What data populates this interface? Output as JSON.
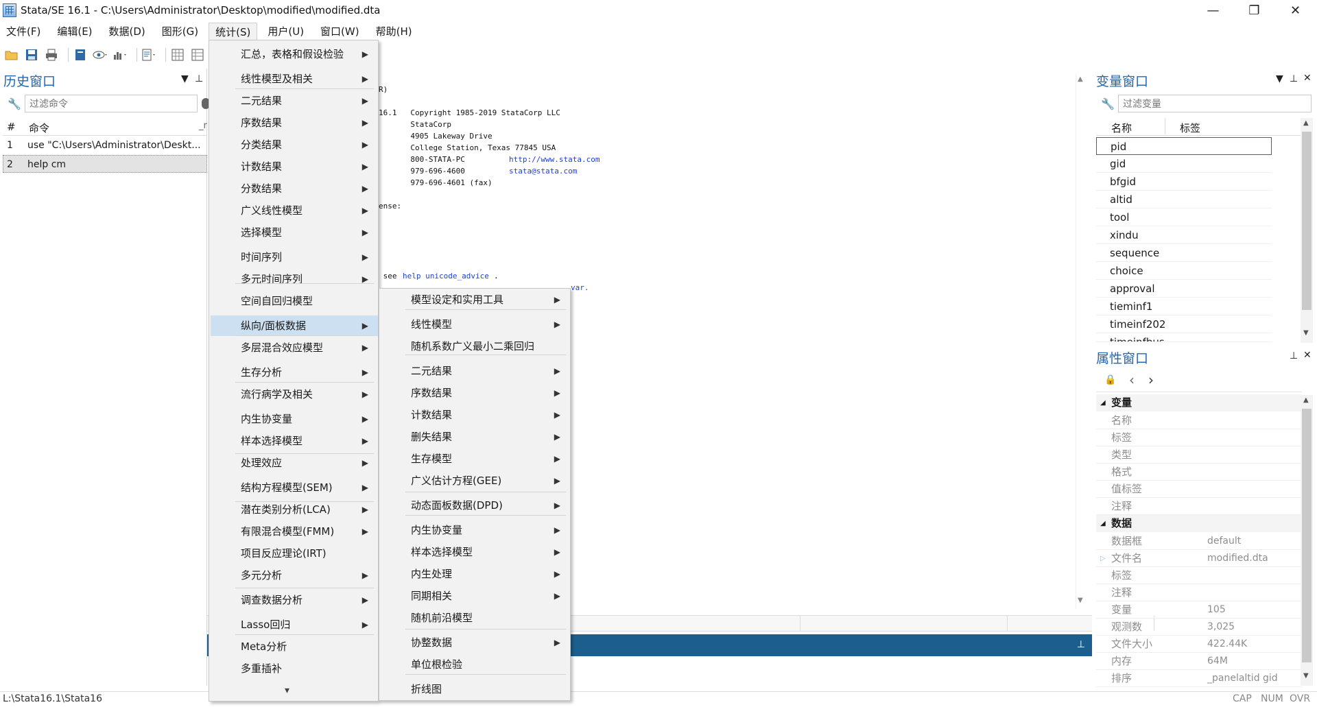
{
  "window": {
    "title": "Stata/SE 16.1 - C:\\Users\\Administrator\\Desktop\\modified\\modified.dta",
    "min": "—",
    "max": "❐",
    "close": "✕"
  },
  "menubar": [
    "文件(F)",
    "编辑(E)",
    "数据(D)",
    "图形(G)",
    "统计(S)",
    "用户(U)",
    "窗口(W)",
    "帮助(H)"
  ],
  "history": {
    "title": "历史窗口",
    "filter_placeholder": "过滤命令",
    "col_num": "#",
    "col_cmd": "命令",
    "col_rc": "_r",
    "rows": [
      {
        "n": "1",
        "cmd": "use \"C:\\Users\\Administrator\\Deskt..."
      },
      {
        "n": "2",
        "cmd": "help cm"
      }
    ]
  },
  "results": {
    "lines": [
      {
        "text": "R)"
      },
      {
        "text": "16.1   Copyright 1985-2019 StataCorp LLC"
      },
      {
        "text": "       StataCorp"
      },
      {
        "text": "       4905 Lakeway Drive"
      },
      {
        "text": "       College Station, Texas 77845 USA"
      },
      {
        "text": "       800-STATA-PC"
      },
      {
        "text": "       979-696-4600"
      },
      {
        "text": "       979-696-4601 (fax)"
      },
      {
        "text": "ense:"
      },
      {
        "text": " see "
      }
    ],
    "url": "http://www.stata.com",
    "email": "stata@stata.com",
    "help_link": "help unicode_advice",
    "help_tail": ".",
    "partial": "var."
  },
  "variables": {
    "title": "变量窗口",
    "filter_placeholder": "过滤变量",
    "col_name": "名称",
    "col_label": "标签",
    "rows": [
      "pid",
      "gid",
      "bfgid",
      "altid",
      "tool",
      "xindu",
      "sequence",
      "choice",
      "approval",
      "tieminf1",
      "timeinf202",
      "timeinfbus"
    ]
  },
  "properties": {
    "title": "属性窗口",
    "sec_var": "变量",
    "var_rows": [
      "名称",
      "标签",
      "类型",
      "格式",
      "值标签",
      "注释"
    ],
    "sec_data": "数据",
    "data_rows": [
      {
        "k": "数据框",
        "v": "default"
      },
      {
        "k": "文件名",
        "v": "modified.dta"
      },
      {
        "k": "标签",
        "v": ""
      },
      {
        "k": "注释",
        "v": ""
      },
      {
        "k": "变量",
        "v": "105"
      },
      {
        "k": "观测数",
        "v": "3,025"
      },
      {
        "k": "文件大小",
        "v": "422.44K"
      },
      {
        "k": "内存",
        "v": "64M"
      },
      {
        "k": "排序",
        "v": "_panelaltid gid"
      }
    ]
  },
  "statusbar": {
    "path": "L:\\Stata16.1\\Stata16",
    "cap": "CAP",
    "num": "NUM",
    "ovr": "OVR"
  },
  "stats_menu": {
    "items": [
      {
        "label": "汇总，表格和假设检验",
        "sub": true
      },
      {
        "label": "线性模型及相关",
        "sub": true
      },
      {
        "label": "二元结果",
        "sub": true
      },
      {
        "label": "序数结果",
        "sub": true
      },
      {
        "label": "分类结果",
        "sub": true
      },
      {
        "label": "计数结果",
        "sub": true
      },
      {
        "label": "分数结果",
        "sub": true
      },
      {
        "label": "广义线性模型",
        "sub": true
      },
      {
        "label": "选择模型",
        "sub": true
      },
      {
        "label": "时间序列",
        "sub": true
      },
      {
        "label": "多元时间序列",
        "sub": true
      },
      {
        "label": "空间自回归模型",
        "sub": false
      },
      {
        "label": "纵向/面板数据",
        "sub": true
      },
      {
        "label": "多层混合效应模型",
        "sub": true
      },
      {
        "label": "生存分析",
        "sub": true
      },
      {
        "label": "流行病学及相关",
        "sub": true
      },
      {
        "label": "内生协变量",
        "sub": true
      },
      {
        "label": "样本选择模型",
        "sub": true
      },
      {
        "label": "处理效应",
        "sub": true
      },
      {
        "label": "结构方程模型(SEM)",
        "sub": true
      },
      {
        "label": "潜在类别分析(LCA)",
        "sub": true
      },
      {
        "label": "有限混合模型(FMM)",
        "sub": true
      },
      {
        "label": "项目反应理论(IRT)",
        "sub": false
      },
      {
        "label": "多元分析",
        "sub": true
      },
      {
        "label": "调查数据分析",
        "sub": true
      },
      {
        "label": "Lasso回归",
        "sub": true
      },
      {
        "label": "Meta分析",
        "sub": false
      },
      {
        "label": "多重插补",
        "sub": false
      }
    ],
    "more": "▾"
  },
  "panel_menu": {
    "items": [
      {
        "label": "模型设定和实用工具",
        "sub": true
      },
      {
        "label": "线性模型",
        "sub": true
      },
      {
        "label": "随机系数广义最小二乘回归",
        "sub": false
      },
      {
        "label": "二元结果",
        "sub": true
      },
      {
        "label": "序数结果",
        "sub": true
      },
      {
        "label": "计数结果",
        "sub": true
      },
      {
        "label": "删失结果",
        "sub": true
      },
      {
        "label": "生存模型",
        "sub": true
      },
      {
        "label": "广义估计方程(GEE)",
        "sub": true
      },
      {
        "label": "动态面板数据(DPD)",
        "sub": true
      },
      {
        "label": "内生协变量",
        "sub": true
      },
      {
        "label": "样本选择模型",
        "sub": true
      },
      {
        "label": "内生处理",
        "sub": true
      },
      {
        "label": "同期相关",
        "sub": true
      },
      {
        "label": "随机前沿模型",
        "sub": false
      },
      {
        "label": "协整数据",
        "sub": true
      },
      {
        "label": "单位根检验",
        "sub": false
      },
      {
        "label": "折线图",
        "sub": false
      }
    ]
  },
  "colors": {
    "accent": "#2167b0",
    "command_bar": "#1c5f8f",
    "menu_highlight": "#cde0f2"
  }
}
